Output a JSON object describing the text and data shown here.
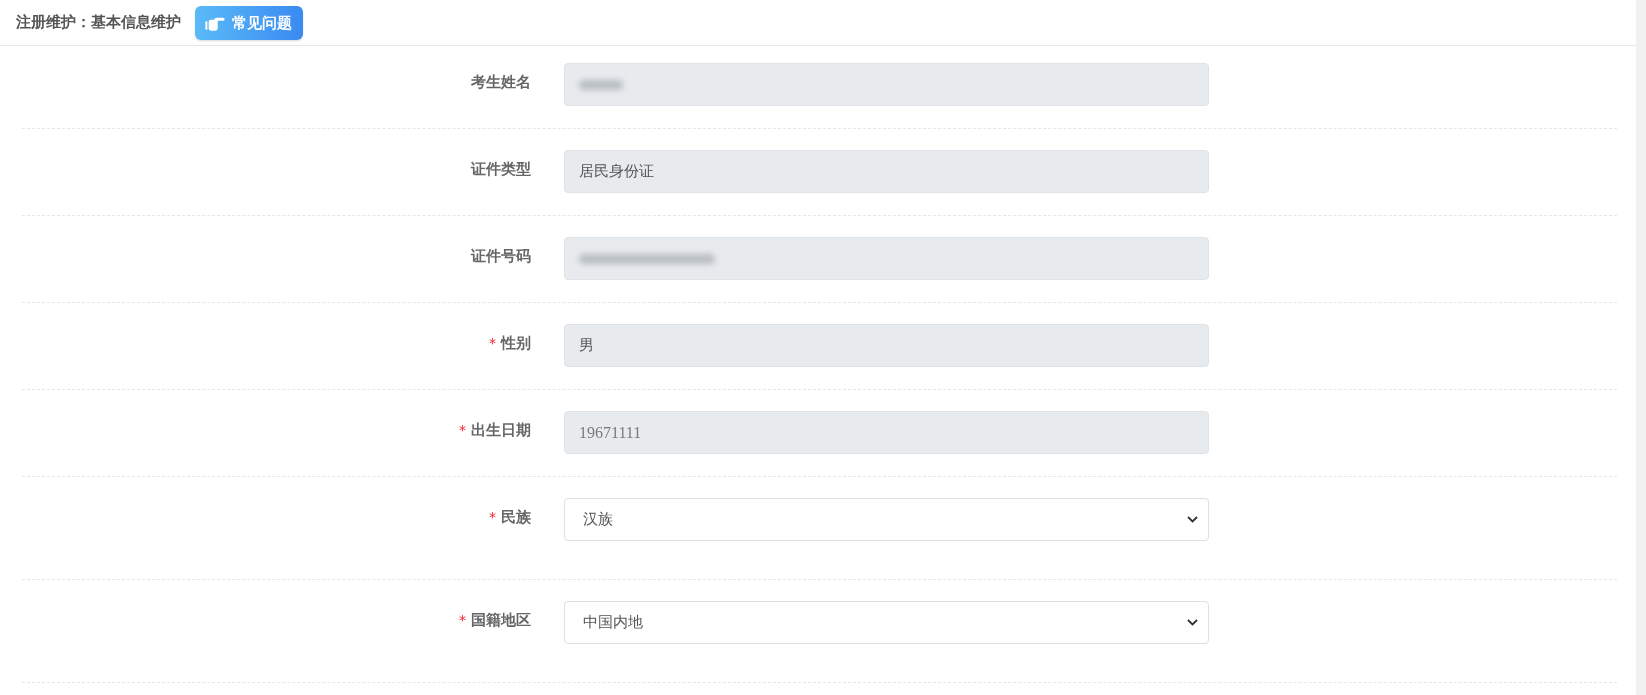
{
  "header": {
    "title": "注册维护：基本信息维护",
    "help_button": {
      "label": "常见问题"
    }
  },
  "fields": [
    {
      "label": "考生姓名",
      "kind": "text",
      "disabled": true,
      "blurred": true
    },
    {
      "label": "证件类型",
      "kind": "text",
      "disabled": true,
      "blurred": false,
      "value": "居民身份证"
    },
    {
      "label": "证件号码",
      "kind": "text",
      "disabled": true,
      "blurred": true
    },
    {
      "label": "性别",
      "required_mark": "*",
      "kind": "text",
      "disabled": true,
      "blurred": false,
      "value": "男"
    },
    {
      "label": "出生日期",
      "required_mark": "*",
      "kind": "date",
      "disabled": true,
      "blurred": false,
      "value": "19671111"
    },
    {
      "label": "民族",
      "required_mark": "*",
      "kind": "select",
      "disabled": false,
      "blurred": false,
      "value": "汉族"
    },
    {
      "label": "国籍地区",
      "required_mark": "*",
      "kind": "select",
      "disabled": false,
      "blurred": false,
      "value": "中国内地"
    }
  ]
}
